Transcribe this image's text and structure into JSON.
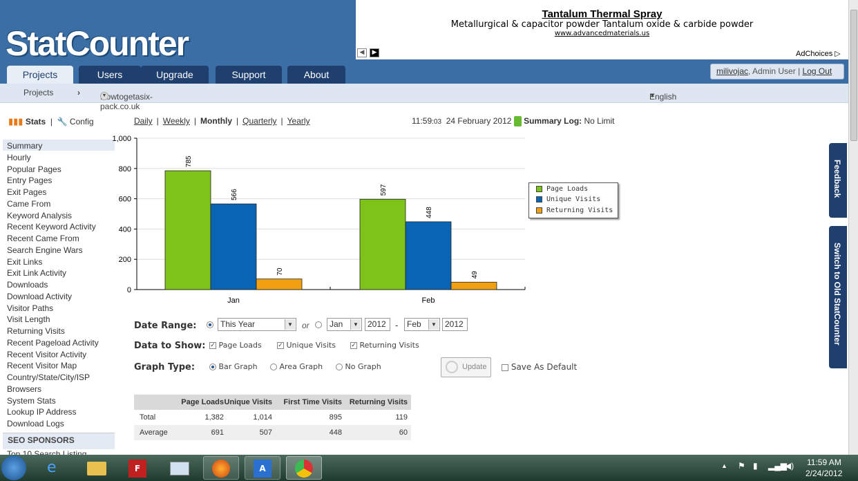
{
  "header": {
    "logo": "StatCounter",
    "tabs": [
      "Projects",
      "Users",
      "Upgrade",
      "Support",
      "About"
    ],
    "user": {
      "name": "milivojac",
      "role": ", Admin User",
      "sep": "|",
      "logout": "Log Out"
    }
  },
  "ad": {
    "title": "Tantalum Thermal Spray",
    "line": "Metallurgical & capacitor powder Tantalum oxide & carbide powder",
    "url": "www.advancedmaterials.us",
    "adchoices": "AdChoices"
  },
  "subnav": {
    "projects": "Projects",
    "arrow": "›",
    "project_name": "Howtogetasix-pack.co.uk",
    "language": "English"
  },
  "leftnav": {
    "stats": "Stats",
    "sep": "|",
    "config": "Config",
    "items": [
      "Summary",
      "Hourly",
      "Popular Pages",
      "Entry Pages",
      "Exit Pages",
      "Came From",
      "Keyword Analysis",
      "Recent Keyword Activity",
      "Recent Came From",
      "Search Engine Wars",
      "Exit Links",
      "Exit Link Activity",
      "Downloads",
      "Download Activity",
      "Visitor Paths",
      "Visit Length",
      "Returning Visits",
      "Recent Pageload Activity",
      "Recent Visitor Activity",
      "Recent Visitor Map",
      "Country/State/City/ISP",
      "Browsers",
      "System Stats",
      "Lookup IP Address",
      "Download Logs"
    ],
    "seo_title": "SEO SPONSORS",
    "seo_item": "Top 10 Search Listing"
  },
  "periods": {
    "items": [
      "Daily",
      "Weekly",
      "Monthly",
      "Quarterly",
      "Yearly"
    ],
    "selected": "Monthly",
    "sep": "|"
  },
  "clock": {
    "time": "11:59",
    "seconds": ":03",
    "date": "24 February 2012",
    "log_label": "Summary Log:",
    "log_value": "No Limit"
  },
  "chart_data": {
    "type": "bar",
    "categories": [
      "Jan",
      "Feb"
    ],
    "series": [
      {
        "name": "Page Loads",
        "values": [
          785,
          597
        ],
        "color": "#7ec31a"
      },
      {
        "name": "Unique Visits",
        "values": [
          566,
          448
        ],
        "color": "#0a64b4"
      },
      {
        "name": "Returning Visits",
        "values": [
          70,
          49
        ],
        "color": "#f0a010"
      }
    ],
    "ylim": [
      0,
      1000
    ],
    "yticks": [
      "0",
      "200",
      "400",
      "600",
      "800",
      "1,000"
    ],
    "legend": "right",
    "grid": true
  },
  "form": {
    "date_range_label": "Date Range:",
    "range_value": "This Year",
    "or": "or",
    "from_month": "Jan",
    "from_year": "2012",
    "dash": "-",
    "to_month": "Feb",
    "to_year": "2012",
    "data_label": "Data to Show:",
    "data_options": [
      "Page Loads",
      "Unique Visits",
      "Returning Visits"
    ],
    "graph_label": "Graph Type:",
    "graph_options": [
      "Bar Graph",
      "Area Graph",
      "No Graph"
    ],
    "update": "Update",
    "save_default": "Save As Default"
  },
  "table": {
    "headers": [
      "",
      "Page Loads",
      "Unique Visits",
      "First Time Visits",
      "Returning Visits"
    ],
    "rows": [
      [
        "Total",
        "1,382",
        "1,014",
        "895",
        "119"
      ],
      [
        "Average",
        "691",
        "507",
        "448",
        "60"
      ]
    ]
  },
  "sidetabs": [
    "Feedback",
    "Switch to Old StatCounter"
  ],
  "tray": {
    "time": "11:59 AM",
    "date": "2/24/2012"
  }
}
